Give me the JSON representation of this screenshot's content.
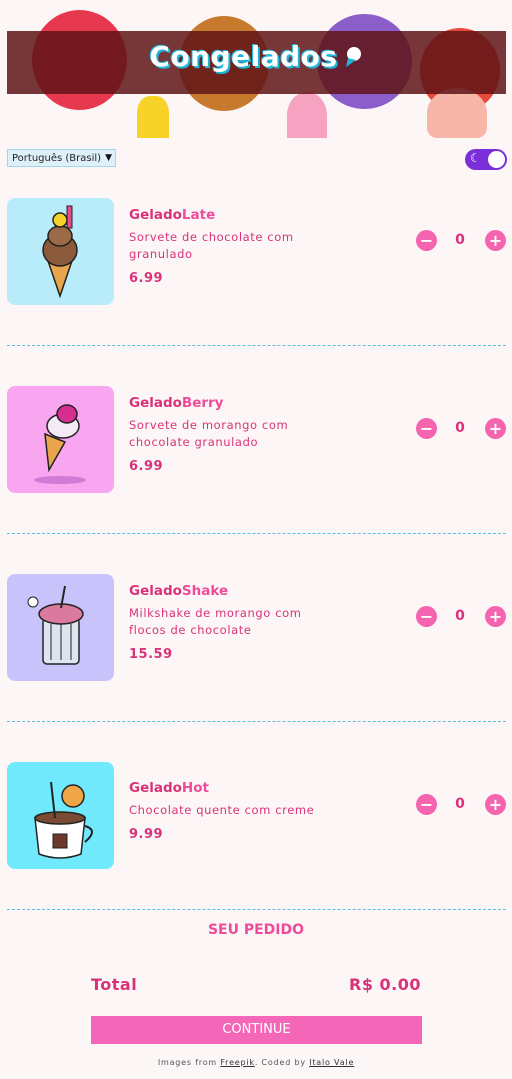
{
  "header": {
    "title": "Congelados"
  },
  "controls": {
    "language": "Português (Brasil)",
    "dark_mode": false
  },
  "products": [
    {
      "name_prefix": "Gelado",
      "name_suffix": "Late",
      "description": "Sorvete de chocolate com granulado",
      "price": "6.99",
      "quantity": "0",
      "image_bg": "#b8ecfb"
    },
    {
      "name_prefix": "Gelado",
      "name_suffix": "Berry",
      "description": "Sorvete de morango com chocolate granulado",
      "price": "6.99",
      "quantity": "0",
      "image_bg": "#f9a6f0"
    },
    {
      "name_prefix": "Gelado",
      "name_suffix": "Shake",
      "description": "Milkshake de morango com flocos de chocolate",
      "price": "15.59",
      "quantity": "0",
      "image_bg": "#c8c4fb"
    },
    {
      "name_prefix": "Gelado",
      "name_suffix": "Hot",
      "description": "Chocolate quente com creme",
      "price": "9.99",
      "quantity": "0",
      "image_bg": "#6fe9fb"
    }
  ],
  "qty_controls": {
    "minus": "−",
    "plus": "+"
  },
  "order": {
    "title": "SEU PEDIDO",
    "total_label": "Total",
    "total_value": "R$ 0.00",
    "continue_label": "CONTINUE"
  },
  "footer": {
    "prefix": "Images from ",
    "freepik": "Freepik",
    "middle": ". Coded by ",
    "author": "Italo Vale"
  }
}
